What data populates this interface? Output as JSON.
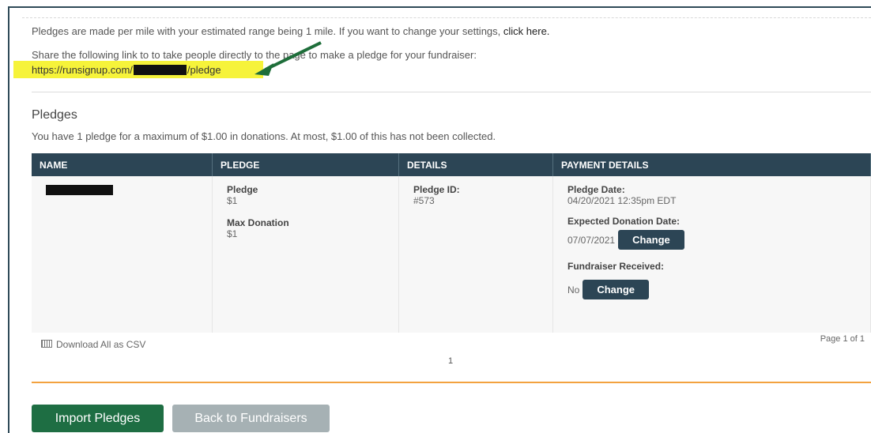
{
  "settings_notice": {
    "text": "Pledges are made per mile with your estimated range being 1 mile. If you want to change your settings, ",
    "link": "click here."
  },
  "share": {
    "text": "Share the following link to to take people directly to the page to make a pledge for your fundraiser:",
    "link_prefix": "https://runsignup.com/",
    "link_suffix": "/pledge"
  },
  "pledges_section": {
    "title": "Pledges",
    "summary": "You have 1 pledge for a maximum of $1.00 in donations. At most, $1.00 of this has not been collected."
  },
  "table": {
    "headers": [
      "NAME",
      "PLEDGE",
      "DETAILS",
      "PAYMENT DETAILS"
    ],
    "row": {
      "pledge_label": "Pledge",
      "pledge_value": "$1",
      "max_donation_label": "Max Donation",
      "max_donation_value": "$1",
      "pledge_id_label": "Pledge ID:",
      "pledge_id_value": "#573",
      "pledge_date_label": "Pledge Date:",
      "pledge_date_value": "04/20/2021 12:35pm EDT",
      "expected_date_label": "Expected Donation Date:",
      "expected_date_value": "07/07/2021",
      "received_label": "Fundraiser Received:",
      "received_value": "No",
      "change_label": "Change"
    }
  },
  "footer": {
    "download_csv": "Download All as CSV",
    "page_info": "Page 1 of 1",
    "page_number": "1"
  },
  "actions": {
    "import": "Import Pledges",
    "back": "Back to Fundraisers"
  },
  "colors": {
    "header_bg": "#2c4555",
    "highlight": "#f6f33a",
    "arrow": "#1e6e3a",
    "primary_button": "#1e6e43",
    "orange_rule": "#f3a23f"
  }
}
